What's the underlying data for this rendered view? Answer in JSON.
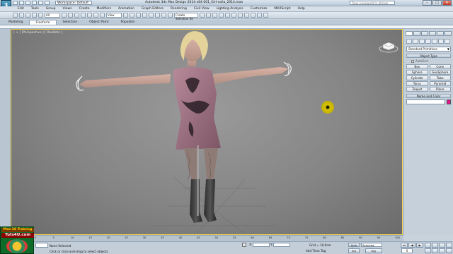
{
  "app": {
    "logo_letter": "3",
    "workspace": "Workspace: Default",
    "title": "Autodesk 3ds Max Design 2014 x64     001_Girl-voila_2014.max",
    "search_placeholder": "Type a keyword or phrase"
  },
  "menu": [
    "Edit",
    "Tools",
    "Group",
    "Views",
    "Create",
    "Modifiers",
    "Animation",
    "Graph Editors",
    "Rendering",
    "Civil View",
    "Lighting Analysis",
    "Customize",
    "MAXScript",
    "Help"
  ],
  "toolbar": {
    "filter": "All",
    "refcoord": "View",
    "selection_set": "Create Selection Se"
  },
  "ribbon": {
    "tabs": [
      "Modeling",
      "Freeform",
      "Selection",
      "Object Paint",
      "Populate"
    ],
    "active_tab": 1
  },
  "viewport": {
    "label": "[ + ] [Perspective ] [ Realistic ]"
  },
  "command_panel": {
    "category": "Standard Primitives",
    "object_type_header": "Object Type",
    "autogrid": "AutoGrid",
    "objects": [
      "Box",
      "Cone",
      "Sphere",
      "GeoSphere",
      "Cylinder",
      "Tube",
      "Torus",
      "Pyramid",
      "Teapot",
      "Plane"
    ],
    "name_color_header": "Name and Color",
    "color": "#e0148e"
  },
  "timeline": {
    "slider": "0 / 100",
    "ticks": [
      "0",
      "5",
      "10",
      "15",
      "20",
      "25",
      "30",
      "35",
      "40",
      "45",
      "50",
      "55",
      "60",
      "65",
      "70",
      "75",
      "80",
      "85",
      "90",
      "95",
      "100"
    ]
  },
  "status": {
    "selection": "None Selected",
    "prompt": "Click or click-and-drag to select objects",
    "x_label": "X:",
    "y_label": "Y:",
    "z_label": "Z:",
    "grid": "Grid = 10,0cm",
    "add_time_tag": "Add Time Tag",
    "auto_key": "Auto Key",
    "set_key": "Set Key",
    "selected": "Selected",
    "key_filters": "Key Filters...",
    "frame": "0"
  },
  "watermark": {
    "line1": "Max 3S Training",
    "line2": "Tuts4U.com"
  }
}
